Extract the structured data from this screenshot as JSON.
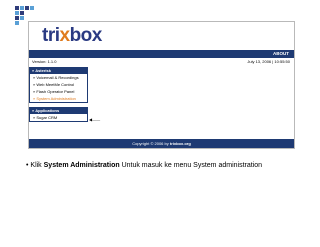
{
  "app": {
    "logo_prefix": "tri",
    "logo_x": "x",
    "logo_suffix": "box",
    "nav_link": "ABOUT",
    "version": "Version: 1.1.0",
    "date": "July 13, 2006 | 10:55:50"
  },
  "sidebar": {
    "asterisk_header": "» Asterisk",
    "items": [
      "» Voicemail & Recordings",
      "» Web MeetMe Control",
      "» Flash Operator Panel",
      "» System Administration"
    ],
    "pointer": "◀——",
    "applications_header": "» Applications",
    "app_items": [
      "» Sugar CRM"
    ]
  },
  "footer": {
    "text": "Copyright © 2006 by",
    "site": "trixbox.org"
  },
  "caption": {
    "bullet": "•",
    "prefix": "Klik",
    "bold": "System Administration",
    "rest": "Untuk masuk ke menu System administration"
  },
  "colors": {
    "navy": "#1e3a73",
    "orange": "#e07b1e"
  }
}
